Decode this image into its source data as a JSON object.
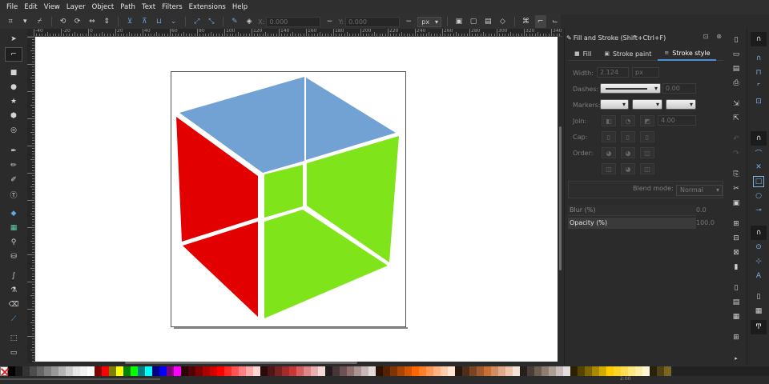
{
  "menu": [
    "File",
    "Edit",
    "View",
    "Layer",
    "Object",
    "Path",
    "Text",
    "Filters",
    "Extensions",
    "Help"
  ],
  "tool_controls": {
    "x_label": "X:",
    "x_value": "0.000",
    "y_label": "Y:",
    "y_value": "0.000",
    "unit": "px"
  },
  "ruler_labels": [
    "-40",
    "-20",
    "0",
    "20",
    "40",
    "60",
    "80",
    "100",
    "120",
    "140",
    "160",
    "180",
    "200",
    "220",
    "240",
    "260",
    "280",
    "300",
    "320",
    "340"
  ],
  "fill_stroke_panel": {
    "title": "Fill and Stroke (Shift+Ctrl+F)",
    "tabs": [
      {
        "label": "Fill",
        "icon": "fill-icon"
      },
      {
        "label": "Stroke paint",
        "icon": "stroke-paint-icon"
      },
      {
        "label": "Stroke style",
        "icon": "stroke-style-icon"
      }
    ],
    "active_tab": "Stroke style",
    "width_label": "Width:",
    "width_value": "2.124",
    "width_unit": "px",
    "dashes_label": "Dashes:",
    "dashes_offset": "0.00",
    "markers_label": "Markers:",
    "join_label": "Join:",
    "miter_value": "4.00",
    "cap_label": "Cap:",
    "order_label": "Order:",
    "blend_label": "Blend mode:",
    "blend_value": "Normal",
    "blur_label": "Blur (%)",
    "blur_value": "0.0",
    "opacity_label": "Opacity (%)",
    "opacity_value": "100.0"
  },
  "cube_colors": {
    "top": "#72a1d3",
    "left": "#e20000",
    "right": "#7fe51a"
  },
  "statusbar": {
    "zoom_text": "2:00"
  }
}
